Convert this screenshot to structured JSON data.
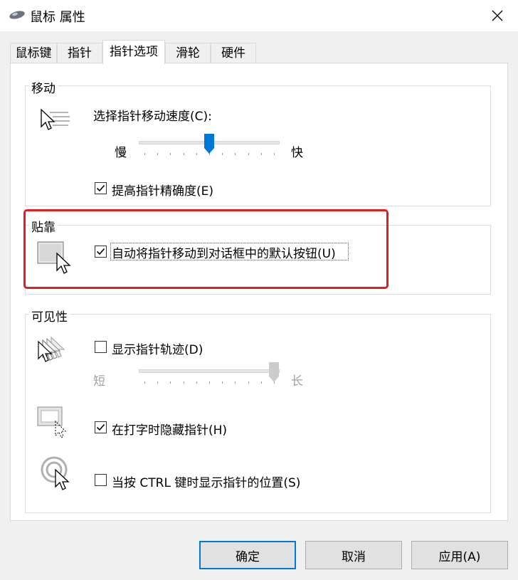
{
  "window": {
    "title": "鼠标 属性",
    "icon": "mouse-icon",
    "close_icon": "close-icon"
  },
  "tabs": [
    {
      "label": "鼠标键",
      "active": false
    },
    {
      "label": "指针",
      "active": false
    },
    {
      "label": "指针选项",
      "active": true
    },
    {
      "label": "滑轮",
      "active": false
    },
    {
      "label": "硬件",
      "active": false
    }
  ],
  "motion": {
    "legend": "移动",
    "speed_label": "选择指针移动速度(C):",
    "slow": "慢",
    "fast": "快",
    "speed_value": 0.5,
    "precision_label": "提高指针精确度(E)",
    "precision_checked": true
  },
  "snap": {
    "legend": "贴靠",
    "snap_label": "自动将指针移动到对话框中的默认按钮(U)",
    "snap_checked": true,
    "highlight_color": "#e02020"
  },
  "visibility": {
    "legend": "可见性",
    "trails_label": "显示指针轨迹(D)",
    "trails_checked": false,
    "short": "短",
    "long": "长",
    "trails_value": 1.0,
    "hide_label": "在打字时隐藏指针(H)",
    "hide_checked": true,
    "ctrl_label": "当按 CTRL 键时显示指针的位置(S)",
    "ctrl_checked": false
  },
  "buttons": {
    "ok": "确定",
    "cancel": "取消",
    "apply": "应用(A)"
  },
  "colors": {
    "accent": "#0078d7",
    "highlight": "#e02020"
  }
}
